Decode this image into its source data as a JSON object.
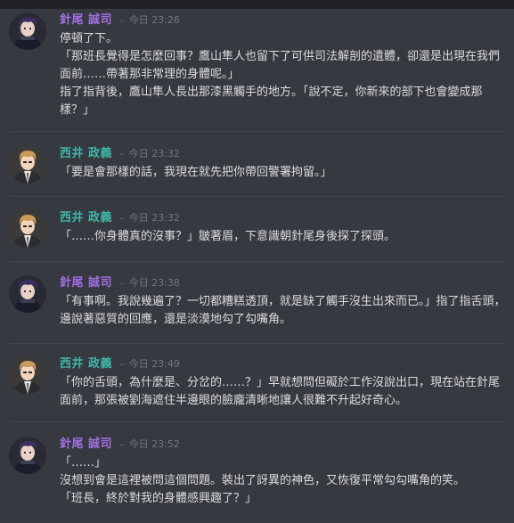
{
  "colors": {
    "background": "#36393f",
    "matsuo_name": "#a06ee0",
    "nishii_name": "#3fb6a8",
    "timestamp": "#72767d",
    "text": "#dcddde"
  },
  "messages": [
    {
      "user": "針尾 誠司",
      "sep": "–",
      "time": "今日 23:26",
      "avatar": "matsuo-avatar-icon",
      "lines": [
        "停頓了下。",
        "「那班長覺得是怎麼回事？鷹山隼人也留下了可供司法解剖的遺體，卻還是出現在我們面前……帶著那非常理的身體呢。」",
        "指了指背後，鷹山隼人長出那漆黑觸手的地方。「說不定，你新來的部下也會變成那樣？」"
      ]
    },
    {
      "user": "西井 政義",
      "sep": "–",
      "time": "今日 23:32",
      "avatar": "nishii-avatar-icon",
      "lines": [
        "「要是會那樣的話，我現在就先把你帶回警署拘留。」"
      ]
    },
    {
      "user": "西井 政義",
      "sep": "–",
      "time": "今日 23:32",
      "avatar": "nishii-avatar-icon",
      "lines": [
        "「……你身體真的沒事？」皺著眉，下意識朝針尾身後探了探頭。"
      ]
    },
    {
      "user": "針尾 誠司",
      "sep": "–",
      "time": "今日 23:38",
      "avatar": "matsuo-avatar-icon",
      "lines": [
        "「有事啊。我說幾遍了？一切都糟糕透頂，就是缺了觸手沒生出來而已。」指了指舌頭，邊說著惡質的回應，還是淡漠地勾了勾嘴角。"
      ]
    },
    {
      "user": "西井 政義",
      "sep": "–",
      "time": "今日 23:49",
      "avatar": "nishii-avatar-icon",
      "lines": [
        "「你的舌頭，為什麼是、分岔的……？」早就想問但礙於工作沒說出口，現在站在針尾面前，那張被劉海遮住半邊眼的臉龐清晰地讓人很難不升起好奇心。"
      ]
    },
    {
      "user": "針尾 誠司",
      "sep": "–",
      "time": "今日 23:52",
      "avatar": "matsuo-avatar-icon",
      "lines": [
        "「……」",
        "沒想到會是這裡被問這個問題。裝出了訝異的神色，又恢復平常勾勾嘴角的笑。",
        "「班長，終於對我的身體感興趣了？」"
      ]
    }
  ]
}
